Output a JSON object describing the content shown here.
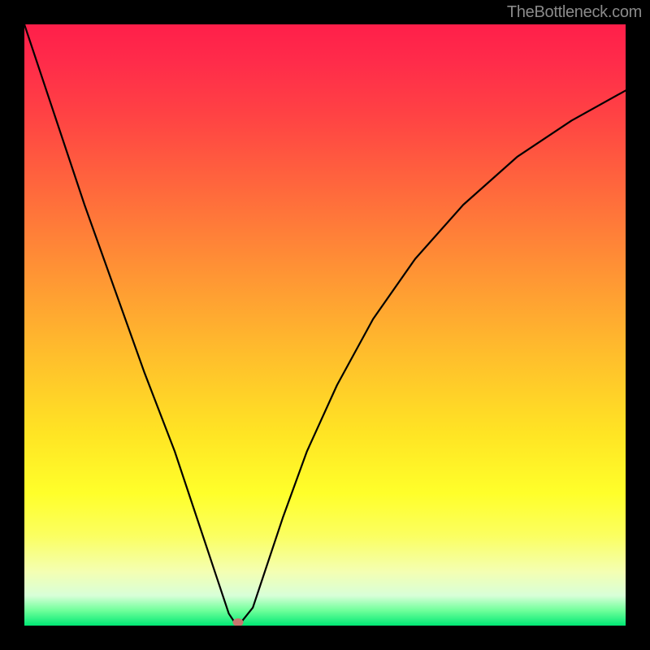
{
  "watermark": "TheBottleneck.com",
  "chart_data": {
    "type": "line",
    "title": "",
    "xlabel": "",
    "ylabel": "",
    "xlim": [
      0,
      100
    ],
    "ylim": [
      0,
      100
    ],
    "grid": false,
    "legend": false,
    "series": [
      {
        "name": "bottleneck-curve",
        "x": [
          0,
          5,
          10,
          15,
          20,
          25,
          28,
          30,
          32,
          33,
          34,
          35,
          36,
          38,
          40,
          43,
          47,
          52,
          58,
          65,
          73,
          82,
          91,
          100
        ],
        "y": [
          100,
          85,
          70,
          56,
          42,
          29,
          20,
          14,
          8,
          5,
          2,
          0.5,
          0.5,
          3,
          9,
          18,
          29,
          40,
          51,
          61,
          70,
          78,
          84,
          89
        ]
      }
    ],
    "marker": {
      "x": 35.5,
      "y": 0.5
    },
    "background_gradient": {
      "stops": [
        {
          "pos": 0.0,
          "color": "#ff1f4a"
        },
        {
          "pos": 0.28,
          "color": "#ff6a3c"
        },
        {
          "pos": 0.55,
          "color": "#ffbe2c"
        },
        {
          "pos": 0.78,
          "color": "#ffff2a"
        },
        {
          "pos": 0.95,
          "color": "#d8ffd8"
        },
        {
          "pos": 1.0,
          "color": "#00e874"
        }
      ]
    }
  }
}
